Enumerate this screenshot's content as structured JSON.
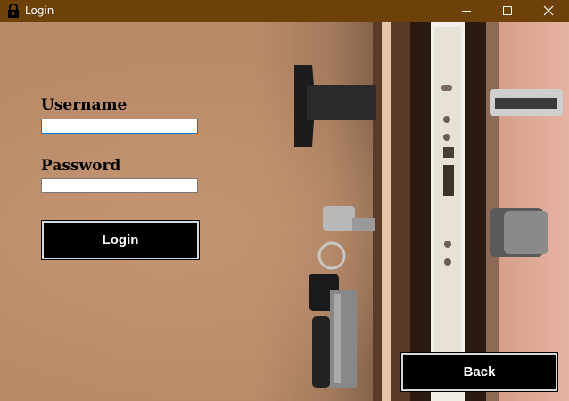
{
  "window": {
    "title": "Login",
    "icon": "lock-icon",
    "controls": [
      "minimize-icon",
      "maximize-icon",
      "close-icon"
    ]
  },
  "form": {
    "username_label": "Username",
    "username_value": "",
    "password_label": "Password",
    "password_value": "",
    "login_label": "Login"
  },
  "footer": {
    "back_label": "Back"
  },
  "colors": {
    "titlebar": "#6e410b",
    "button_bg": "#000000",
    "button_text": "#ffffff"
  }
}
